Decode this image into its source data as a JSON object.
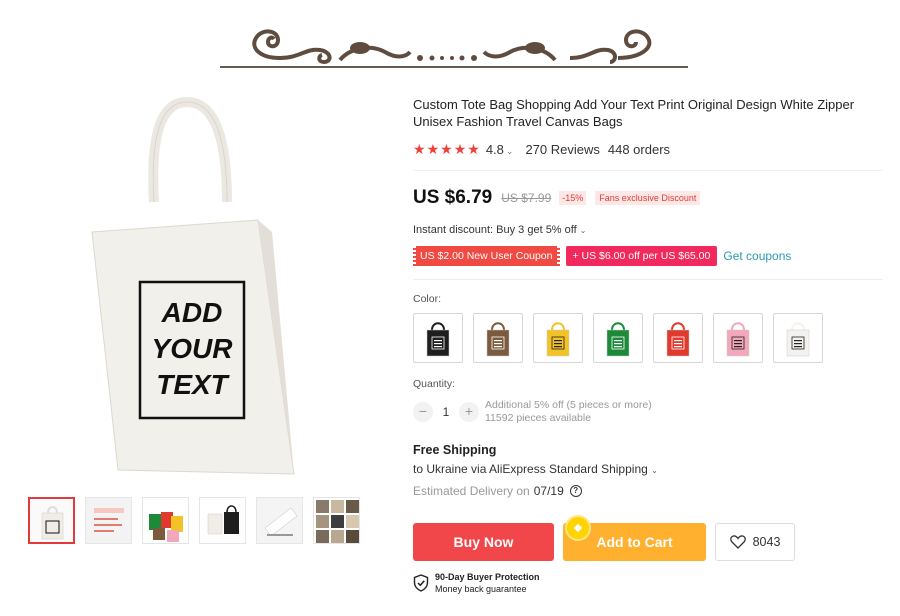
{
  "product": {
    "title": "Custom Tote Bag Shopping Add Your Text Print Original Design White Zipper Unisex Fashion Travel Canvas Bags",
    "bag_print": [
      "ADD",
      "YOUR",
      "TEXT"
    ]
  },
  "rating": {
    "stars": 5,
    "value": "4.8",
    "reviews": "270 Reviews",
    "orders": "448 orders"
  },
  "price": {
    "current": "US $6.79",
    "original": "US $7.99",
    "discount": "-15%",
    "fans_badge": "Fans exclusive Discount"
  },
  "instant_discount": "Instant discount: Buy 3 get 5% off",
  "coupons": {
    "new_user": "US $2.00 New User Coupon",
    "store": "+ US $6.00 off per US $65.00",
    "get_link": "Get coupons"
  },
  "color": {
    "label": "Color:",
    "swatches": [
      {
        "name": "black",
        "hex": "#1e1e1e"
      },
      {
        "name": "brown",
        "hex": "#7b5a3e"
      },
      {
        "name": "yellow",
        "hex": "#f2c326"
      },
      {
        "name": "green",
        "hex": "#1d8a3a"
      },
      {
        "name": "red",
        "hex": "#e0392d"
      },
      {
        "name": "pink",
        "hex": "#f3a7bb"
      },
      {
        "name": "white",
        "hex": "#f4f2ee"
      }
    ]
  },
  "quantity": {
    "label": "Quantity:",
    "value": "1",
    "minus": "−",
    "plus": "+",
    "bulk_note": "Additional 5% off (5 pieces or more)",
    "available": "11592 pieces available"
  },
  "shipping": {
    "title": "Free Shipping",
    "to": "to Ukraine via AliExpress Standard Shipping",
    "delivery_label": "Estimated Delivery on",
    "delivery_date": "07/19"
  },
  "actions": {
    "buy_now": "Buy Now",
    "add_to_cart": "Add to Cart",
    "wishlist_count": "8043"
  },
  "protection": {
    "title": "90-Day Buyer Protection",
    "subtitle": "Money back guarantee"
  },
  "colors": {
    "accent_red": "#f2474a",
    "cart_orange": "#ffb02e",
    "link_teal": "#2b9bb0"
  }
}
